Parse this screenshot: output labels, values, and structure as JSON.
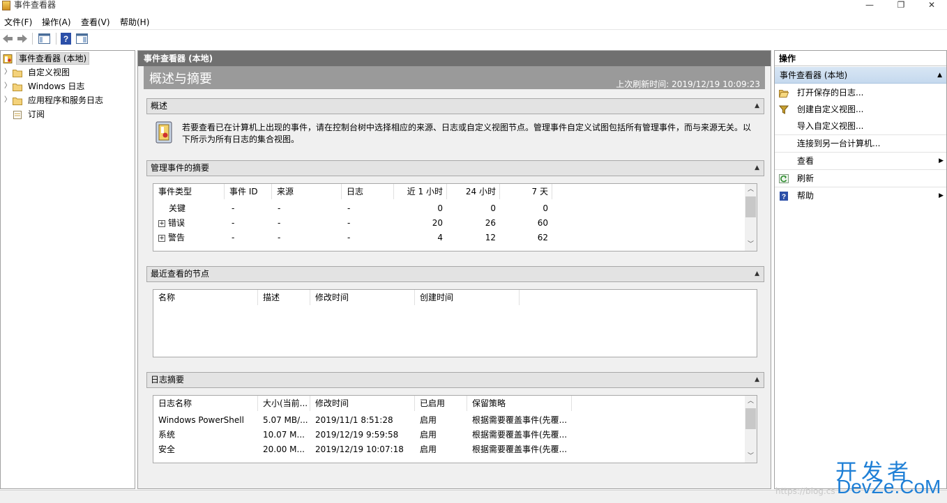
{
  "window": {
    "title": "事件查看器"
  },
  "menu": [
    "文件(F)",
    "操作(A)",
    "查看(V)",
    "帮助(H)"
  ],
  "tree": [
    {
      "label": "事件查看器 (本地)",
      "selected": true
    },
    {
      "label": "自定义视图"
    },
    {
      "label": "Windows 日志"
    },
    {
      "label": "应用程序和服务日志"
    },
    {
      "label": "订阅"
    }
  ],
  "center": {
    "header": "事件查看器 (本地)",
    "banner_title": "概述与摘要",
    "last_refresh": "上次刷新时间: 2019/12/19 10:09:23",
    "overview": {
      "title": "概述",
      "text": "若要查看已在计算机上出现的事件，请在控制台树中选择相应的来源、日志或自定义视图节点。管理事件自定义试图包括所有管理事件，而与来源无关。以下所示为所有日志的集合视图。"
    },
    "admin_summary": {
      "title": "管理事件的摘要",
      "columns": [
        "事件类型",
        "事件 ID",
        "来源",
        "日志",
        "近 1 小时",
        "24 小时",
        "7 天"
      ],
      "rows": [
        {
          "type": "关键",
          "id": "-",
          "source": "-",
          "log": "-",
          "h1": "0",
          "h24": "0",
          "d7": "0"
        },
        {
          "type": "错误",
          "id": "-",
          "source": "-",
          "log": "-",
          "h1": "20",
          "h24": "26",
          "d7": "60"
        },
        {
          "type": "警告",
          "id": "-",
          "source": "-",
          "log": "-",
          "h1": "4",
          "h24": "12",
          "d7": "62"
        }
      ]
    },
    "recent": {
      "title": "最近查看的节点",
      "columns": [
        "名称",
        "描述",
        "修改时间",
        "创建时间"
      ]
    },
    "log_summary": {
      "title": "日志摘要",
      "columns": [
        "日志名称",
        "大小(当前...",
        "修改时间",
        "已启用",
        "保留策略"
      ],
      "rows": [
        {
          "name": "Windows PowerShell",
          "size": "5.07 MB/...",
          "modified": "2019/11/1 8:51:28",
          "enabled": "启用",
          "policy": "根据需要覆盖事件(先覆..."
        },
        {
          "name": "系统",
          "size": "10.07 M...",
          "modified": "2019/12/19 9:59:58",
          "enabled": "启用",
          "policy": "根据需要覆盖事件(先覆..."
        },
        {
          "name": "安全",
          "size": "20.00 M...",
          "modified": "2019/12/19 10:07:18",
          "enabled": "启用",
          "policy": "根据需要覆盖事件(先覆..."
        }
      ]
    }
  },
  "actions": {
    "header": "操作",
    "group": "事件查看器 (本地)",
    "items": [
      {
        "label": "打开保存的日志...",
        "icon": "open-folder-icon"
      },
      {
        "label": "创建自定义视图...",
        "icon": "filter-icon"
      },
      {
        "label": "导入自定义视图..."
      },
      {
        "label": "连接到另一台计算机..."
      },
      {
        "label": "查看",
        "submenu": true
      },
      {
        "label": "刷新",
        "icon": "refresh-icon"
      },
      {
        "label": "帮助",
        "icon": "help-icon",
        "submenu": true
      }
    ]
  },
  "watermark": {
    "line1": "开发者",
    "line2": "DevZe.CoM",
    "url": "https://blog.cs"
  }
}
